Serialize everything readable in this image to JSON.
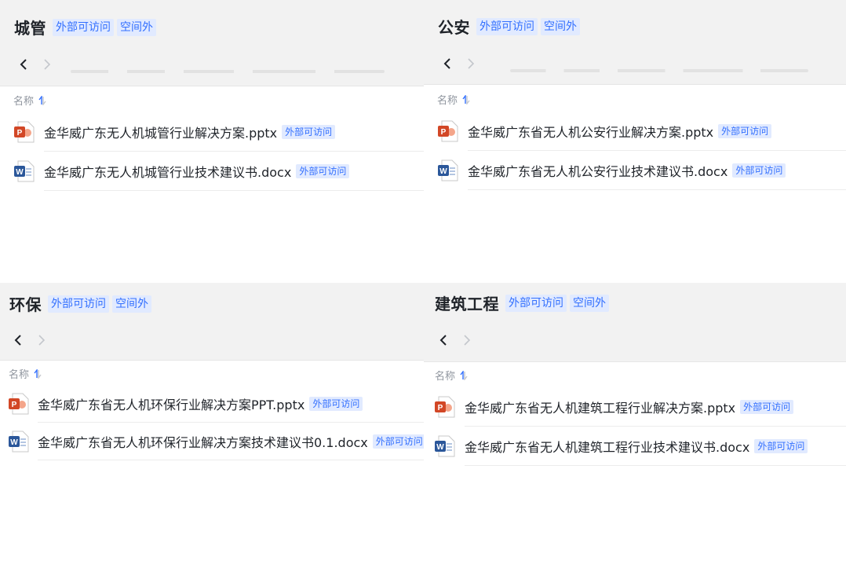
{
  "column_header": "名称",
  "panels": [
    {
      "title": "城管",
      "tags": [
        "外部可访问",
        "空间外"
      ],
      "files": [
        {
          "name": "金华威广东无人机城管行业解决方案.pptx",
          "type": "pptx",
          "tag": "外部可访问"
        },
        {
          "name": "金华威广东无人机城管行业技术建议书.docx",
          "type": "docx",
          "tag": "外部可访问"
        }
      ]
    },
    {
      "title": "公安",
      "tags": [
        "外部可访问",
        "空间外"
      ],
      "files": [
        {
          "name": "金华威广东省无人机公安行业解决方案.pptx",
          "type": "pptx",
          "tag": "外部可访问"
        },
        {
          "name": "金华威广东省无人机公安行业技术建议书.docx",
          "type": "docx",
          "tag": "外部可访问"
        }
      ]
    },
    {
      "title": "环保",
      "tags": [
        "外部可访问",
        "空间外"
      ],
      "files": [
        {
          "name": "金华威广东省无人机环保行业解决方案PPT.pptx",
          "type": "pptx",
          "tag": "外部可访问"
        },
        {
          "name": "金华威广东省无人机环保行业解决方案技术建议书0.1.docx",
          "type": "docx",
          "tag": "外部可访问"
        }
      ]
    },
    {
      "title": "建筑工程",
      "tags": [
        "外部可访问",
        "空间外"
      ],
      "files": [
        {
          "name": "金华威广东省无人机建筑工程行业解决方案.pptx",
          "type": "pptx",
          "tag": "外部可访问"
        },
        {
          "name": "金华威广东省无人机建筑工程行业技术建议书.docx",
          "type": "docx",
          "tag": "外部可访问"
        }
      ]
    }
  ],
  "icons": {
    "back": "chevron-left-icon",
    "forward": "chevron-right-icon",
    "sort": "sort-icon",
    "pptx": "powerpoint-file-icon",
    "docx": "word-file-icon"
  },
  "colors": {
    "tag_bg": "#e1eaff",
    "tag_text": "#3370ff",
    "ppt_orange": "#d24726",
    "word_blue": "#2b579a"
  }
}
